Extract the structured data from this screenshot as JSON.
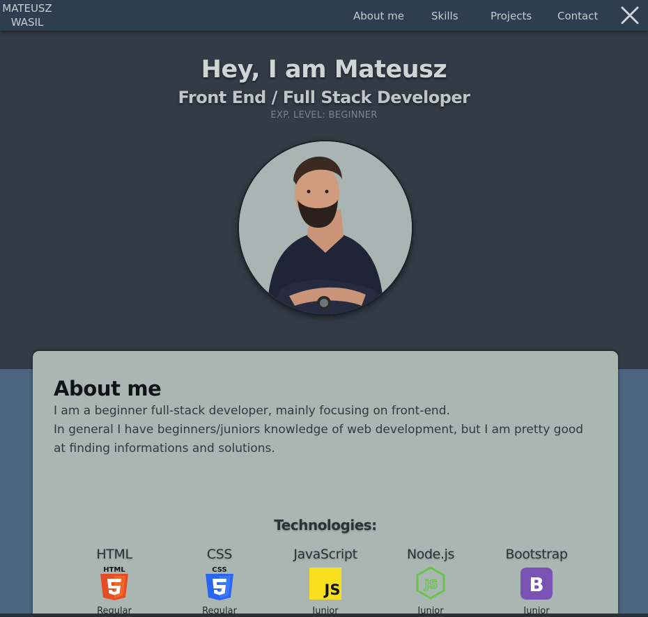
{
  "brand": {
    "line1": "MATEUSZ",
    "line2": "WASIL"
  },
  "nav": {
    "items": [
      {
        "label": "About me"
      },
      {
        "label": "Skills"
      },
      {
        "label": "Projects"
      },
      {
        "label": "Contact"
      }
    ],
    "close_icon": "close-icon"
  },
  "hero": {
    "title": "Hey, I am Mateusz",
    "subtitle": "Front End / Full Stack Developer",
    "level": "EXP. LEVEL: BEGINNER"
  },
  "about": {
    "heading": "About me",
    "paragraphs": [
      "I am a beginner full-stack developer, mainly focusing on front-end.",
      "In general I have beginners/juniors knowledge of web development, but I am pretty good at finding informations and solutions."
    ]
  },
  "technologies": {
    "heading": "Technologies:",
    "items": [
      {
        "name": "HTML",
        "level": "Regular",
        "logo": "html5-logo-icon",
        "logo_text": "HTML",
        "color": "#e44d26"
      },
      {
        "name": "CSS",
        "level": "Regular",
        "logo": "css3-logo-icon",
        "logo_text": "CSS",
        "color": "#2965f1"
      },
      {
        "name": "JavaScript",
        "level": "Junior",
        "logo": "javascript-logo-icon",
        "logo_text": "JS",
        "color": "#f7df1e"
      },
      {
        "name": "Node.js",
        "level": "Junior",
        "logo": "nodejs-logo-icon",
        "logo_text": "JS",
        "color": "#6cc24a"
      },
      {
        "name": "Bootstrap",
        "level": "Junior",
        "logo": "bootstrap-logo-icon",
        "logo_text": "B",
        "color": "#7952b3"
      }
    ]
  },
  "colors": {
    "navbar": "#2e3e50",
    "hero_bg": "#333b46",
    "page_bg": "#4b6580",
    "card_bg": "#a9b6b2"
  }
}
